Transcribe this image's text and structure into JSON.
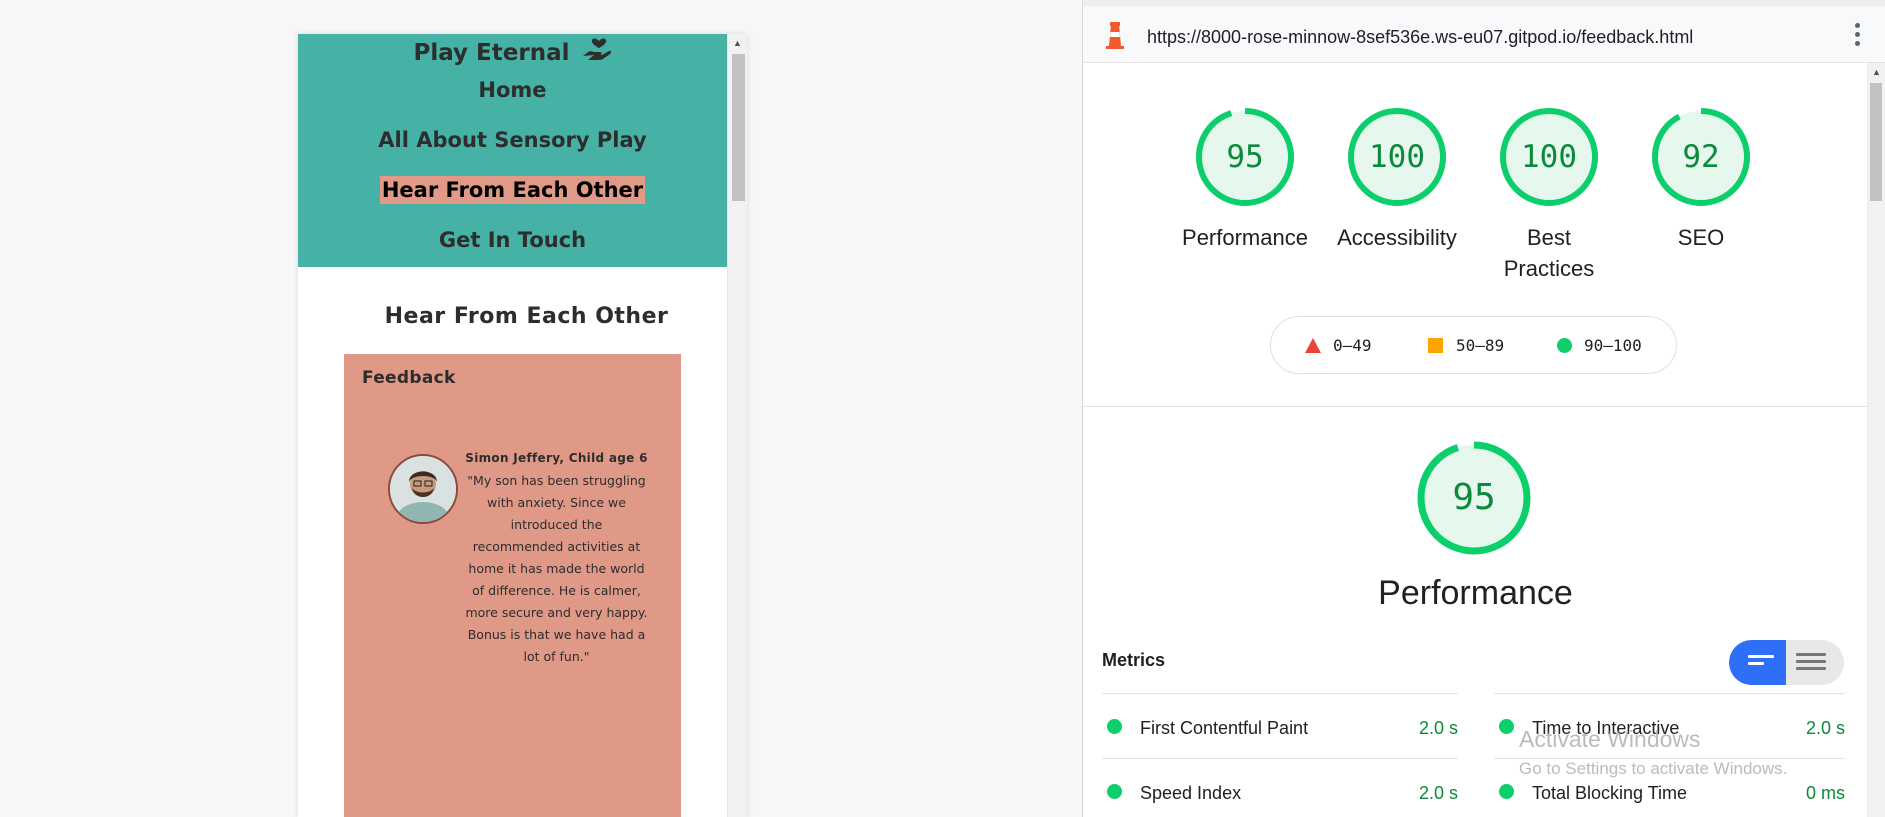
{
  "site": {
    "brand": "Play Eternal",
    "nav": [
      {
        "label": "Home",
        "active": false
      },
      {
        "label": "All About Sensory Play",
        "active": false
      },
      {
        "label": "Hear From Each Other",
        "active": true
      },
      {
        "label": "Get In Touch",
        "active": false
      }
    ],
    "page_title": "Hear From Each Other",
    "feedback": {
      "heading": "Feedback",
      "name": "Simon Jeffery, Child age 6",
      "quote": "\"My son has been struggling with anxiety. Since we introduced the recommended activities at home it has made the world of difference. He is calmer, more secure and very happy. Bonus is that we have had a lot of fun.\""
    },
    "colors": {
      "header": "#46b2a6",
      "card": "#df9986",
      "active_nav": "#e09a87"
    }
  },
  "lighthouse": {
    "url": "https://8000-rose-minnow-8sef536e.ws-eu07.gitpod.io/feedback.html",
    "scores": [
      {
        "label": "Performance",
        "value": "95",
        "score": 95
      },
      {
        "label": "Accessibility",
        "value": "100",
        "score": 100
      },
      {
        "label": "Best Practices",
        "value": "100",
        "score": 100
      },
      {
        "label": "SEO",
        "value": "92",
        "score": 92
      }
    ],
    "legend": {
      "fail": "0–49",
      "average": "50–89",
      "pass": "90–100"
    },
    "section": {
      "score": "95",
      "title": "Performance"
    },
    "metrics_title": "Metrics",
    "metrics": [
      {
        "name": "First Contentful Paint",
        "value": "2.0 s"
      },
      {
        "name": "Time to Interactive",
        "value": "2.0 s"
      },
      {
        "name": "Speed Index",
        "value": "2.0 s"
      },
      {
        "name": "Total Blocking Time",
        "value": "0 ms"
      }
    ],
    "colors": {
      "pass": "#0cce6b",
      "pass_text": "#0b8a3b",
      "average": "#fda402",
      "fail": "#eb4335",
      "toggle_on": "#2f6ef6"
    }
  },
  "watermark": {
    "line1": "Activate Windows",
    "line2": "Go to Settings to activate Windows."
  }
}
